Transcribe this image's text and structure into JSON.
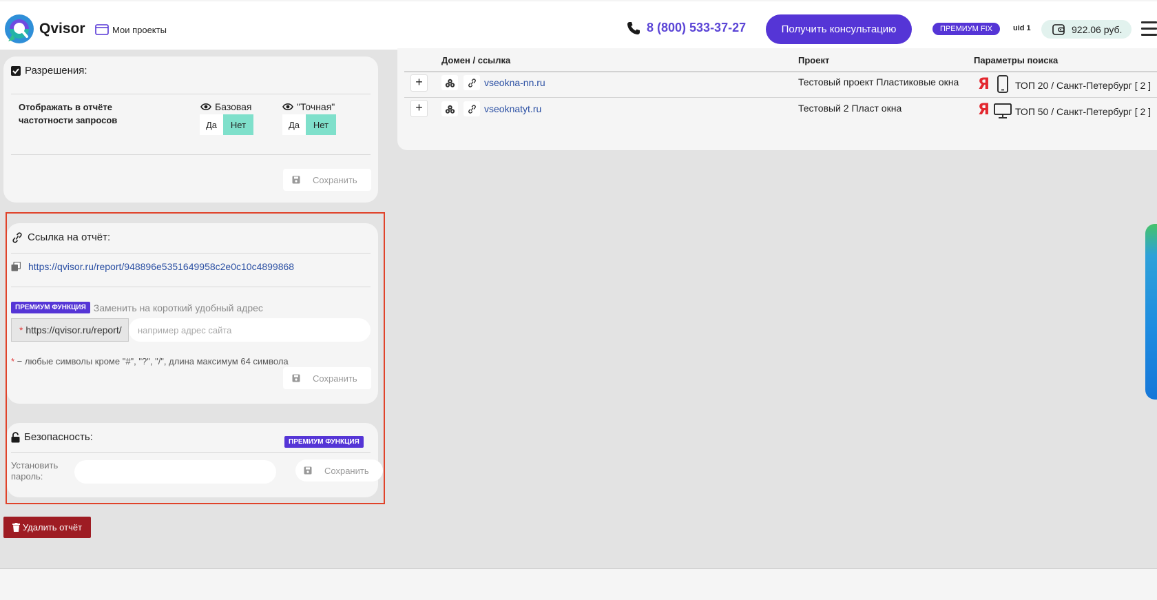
{
  "header": {
    "logo_text": "Qvisor",
    "projects_link": "Мои проекты",
    "phone": "8 (800) 533-37-27",
    "consult_button": "Получить консультацию",
    "premium_badge": "ПРЕМИУМ FIX",
    "uid": "uid 1",
    "balance": "922.06 руб."
  },
  "permissions": {
    "title": "Разрешения:",
    "label": "Отображать в отчёте частотности запросов",
    "basic": {
      "label": "Базовая",
      "yes": "Да",
      "no": "Нет",
      "selected": "Нет"
    },
    "exact": {
      "label": "\"Точная\"",
      "yes": "Да",
      "no": "Нет",
      "selected": "Нет"
    },
    "save": "Сохранить"
  },
  "report_link": {
    "title": "Ссылка на отчёт:",
    "url": "https://qvisor.ru/report/948896e5351649958c2e0c10c4899868",
    "premium_label": "ПРЕМИУМ ФУНКЦИЯ",
    "short_hint": "Заменить на короткий удобный адрес",
    "prefix_star": "*",
    "prefix": "https://qvisor.ru/report/",
    "alias_placeholder": "например адрес сайта",
    "note_star": "*",
    "note": " − любые символы кроме \"#\", \"?\", \"/\", длина максимум 64 символа",
    "save": "Сохранить"
  },
  "security": {
    "title": "Безопасность:",
    "premium_label": "ПРЕМИУМ ФУНКЦИЯ",
    "password_label": "Установить пароль:",
    "save": "Сохранить"
  },
  "delete_button": "Удалить отчёт",
  "table": {
    "columns": [
      "Домен / ссылка",
      "Проект",
      "Параметры поиска"
    ],
    "rows": [
      {
        "domain": "vseokna-nn.ru",
        "project": "Тестовый проект Пластиковые окна",
        "engine": "Я",
        "device": "mobile-icon",
        "params": "ТОП 20 / Санкт-Петербург [ 2 ]"
      },
      {
        "domain": "vseoknatyt.ru",
        "project": "Тестовый 2 Пласт окна",
        "engine": "Я",
        "device": "desktop-icon",
        "params": "ТОП 50 / Санкт-Петербург [ 2 ]"
      }
    ]
  },
  "colors": {
    "accent": "#5535d6",
    "toggle_active": "#7fe0cb",
    "delete": "#9e1c23",
    "highlight": "#e0432a",
    "link": "#2a4fa3"
  }
}
